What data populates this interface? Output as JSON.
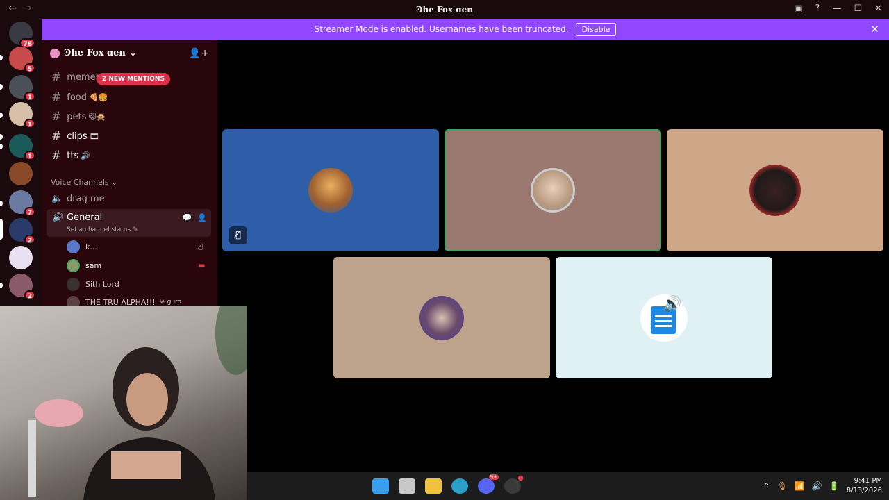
{
  "window": {
    "title": "Ͽhe Fox ɑen",
    "back_icon": "←",
    "forward_icon": "→",
    "controls": [
      "▣",
      "?",
      "—",
      "☐",
      "✕"
    ]
  },
  "banner": {
    "text": "Streamer Mode is enabled. Usernames have been truncated.",
    "button": "Disable",
    "close": "✕"
  },
  "servers": [
    {
      "badge": "76",
      "color": "#3a3a44"
    },
    {
      "badge": "5",
      "color": "#c94a4a"
    },
    {
      "badge": "1",
      "color": "#4a5058"
    },
    {
      "badge": "1",
      "color": "#d8c0a8"
    },
    {
      "badge": "1",
      "color": "#1c5a5a"
    },
    {
      "badge": "",
      "color": "#8a4a2a"
    },
    {
      "badge": "7",
      "color": "#6a7aa0"
    },
    {
      "badge": "2",
      "color": "#2a3a6a"
    },
    {
      "badge": "",
      "color": "#e8e0f0"
    },
    {
      "badge": "2",
      "color": "#8a5a6a"
    }
  ],
  "sidebar": {
    "server_name": "Ͽhe Fox ɑen",
    "chevron": "⌄",
    "invite_icon": "👤+",
    "mentions_pill": "2 NEW MENTIONS",
    "channels": [
      {
        "name": "memes",
        "emoji": ""
      },
      {
        "name": "food",
        "emoji": "🍕🍔"
      },
      {
        "name": "pets",
        "emoji": "😺🙊"
      },
      {
        "name": "clips",
        "emoji": "🎞"
      },
      {
        "name": "tts",
        "emoji": "🔊"
      }
    ],
    "hash": "#",
    "voice_header": "Voice Channels",
    "voice_chevron": "⌄",
    "voice_channels": [
      {
        "name": "drag me"
      }
    ],
    "general": {
      "name": "General",
      "status": "Set a channel status ✎",
      "chat_icon": "💬",
      "add_icon": "👤"
    },
    "members": [
      {
        "name": "k...",
        "color": "#5a78c8",
        "right": "🎙̸"
      },
      {
        "name": "sam",
        "color": "#8a9a6a",
        "right": "▬"
      },
      {
        "name": "Sith Lord",
        "color": "#3a3030",
        "right": ""
      },
      {
        "name": "THE TRU ALPHA!!!",
        "color": "#5a4040",
        "right": "",
        "tag": "☠ guro"
      }
    ]
  },
  "stage": {
    "tiles": [
      {
        "bg": "#2f5ea8",
        "avatar": "#c88a3a",
        "muted": true
      },
      {
        "bg": "#9a7870",
        "avatar": "#d8c8b0",
        "speaking": true
      },
      {
        "bg": "#cda787",
        "avatar": "#201a1a"
      },
      {
        "bg": "#bda38b",
        "avatar": "#4a3a7a"
      },
      {
        "bg": "#dff1f4",
        "avatar": "doc"
      }
    ],
    "muted_icon": "🎙̸"
  },
  "taskbar": {
    "apps": [
      {
        "name": "windows",
        "color": "#3a9ef0"
      },
      {
        "name": "task-view",
        "color": "#c8c8c8"
      },
      {
        "name": "explorer",
        "color": "#f0c040"
      },
      {
        "name": "edge",
        "color": "#2aa0c8"
      },
      {
        "name": "discord",
        "color": "#5865f2",
        "badge": "9+"
      },
      {
        "name": "obs",
        "color": "#3a3a3a",
        "badge": "●"
      }
    ],
    "tray": {
      "chevron": "⌃",
      "mic": "🎙",
      "wifi": "📶",
      "volume": "🔊",
      "battery": "🔋",
      "time": "9:41 PM",
      "date": "8/13/2026"
    }
  }
}
